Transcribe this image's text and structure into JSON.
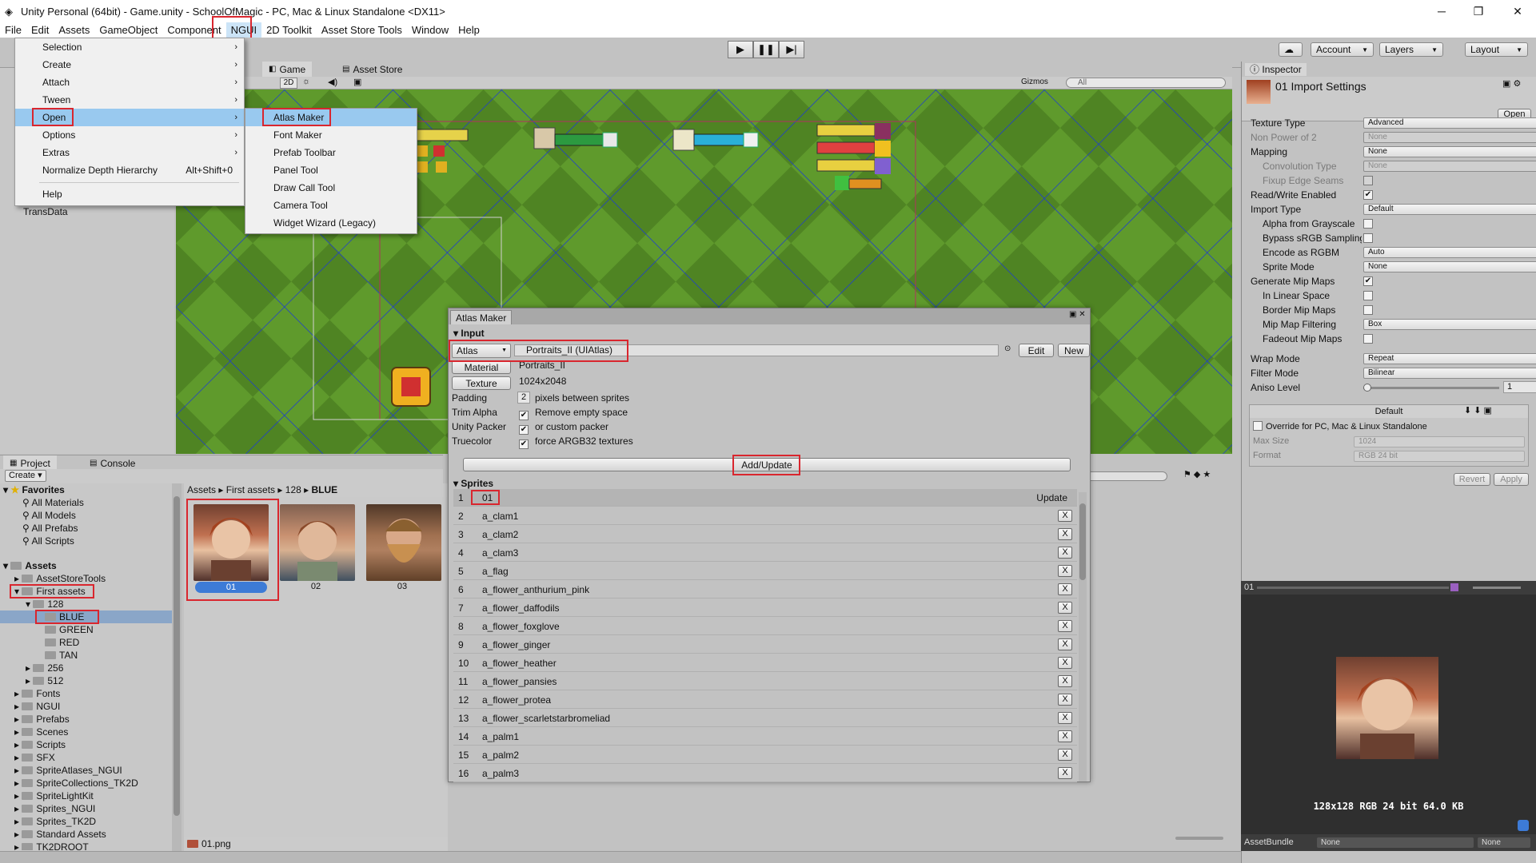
{
  "window": {
    "title": "Unity Personal (64bit) - Game.unity - SchoolOfMagic - PC, Mac & Linux Standalone <DX11>",
    "minimize": "─",
    "maximize": "❐",
    "close": "✕"
  },
  "menubar": [
    "File",
    "Edit",
    "Assets",
    "GameObject",
    "Component",
    "NGUI",
    "2D Toolkit",
    "Asset Store Tools",
    "Window",
    "Help"
  ],
  "toolbar": {
    "account": "Account",
    "layers": "Layers",
    "layout": "Layout"
  },
  "game_tabs": {
    "game": "Game",
    "asset_store": "Asset Store",
    "mode_2d": "2D",
    "gizmos": "Gizmos",
    "search_placeholder": "All"
  },
  "hierarchy": {
    "visible_item": "TransData"
  },
  "ngui_menu": {
    "items": [
      {
        "label": "Selection",
        "arrow": "›"
      },
      {
        "label": "Create",
        "arrow": "›"
      },
      {
        "label": "Attach",
        "arrow": "›"
      },
      {
        "label": "Tween",
        "arrow": "›"
      },
      {
        "label": "Open",
        "arrow": "›"
      },
      {
        "label": "Options",
        "arrow": "›"
      },
      {
        "label": "Extras",
        "arrow": "›"
      },
      {
        "label": "Normalize Depth Hierarchy",
        "accel": "Alt+Shift+0"
      },
      {
        "label": "Help"
      }
    ]
  },
  "open_submenu": {
    "items": [
      "Atlas Maker",
      "Font Maker",
      "Prefab Toolbar",
      "Panel Tool",
      "Draw Call Tool",
      "Camera Tool",
      "Widget Wizard (Legacy)"
    ]
  },
  "project": {
    "tab_project": "Project",
    "tab_console": "Console",
    "create": "Create",
    "breadcrumb": [
      "Assets",
      "First assets",
      "128",
      "BLUE"
    ],
    "favorites": {
      "title": "Favorites",
      "items": [
        "All Materials",
        "All Models",
        "All Prefabs",
        "All Scripts"
      ]
    },
    "assets_title": "Assets",
    "tree": [
      "AssetStoreTools",
      "First assets",
      "128",
      "BLUE",
      "GREEN",
      "RED",
      "TAN",
      "256",
      "512",
      "Fonts",
      "NGUI",
      "Prefabs",
      "Scenes",
      "Scripts",
      "SFX",
      "SpriteAtlases_NGUI",
      "SpriteCollections_TK2D",
      "SpriteLightKit",
      "Sprites_NGUI",
      "Sprites_TK2D",
      "Standard Assets",
      "TK2DROOT"
    ],
    "thumbs": [
      "01",
      "02",
      "03"
    ],
    "footer_file": "01.png"
  },
  "atlas_maker": {
    "title": "Atlas Maker",
    "input_header": "Input",
    "atlas_label": "Atlas",
    "atlas_value": "Portraits_II (UIAtlas)",
    "edit": "Edit",
    "new": "New",
    "material_label": "Material",
    "material_value": "Portraits_II",
    "texture_label": "Texture",
    "texture_value": "1024x2048",
    "padding_label": "Padding",
    "padding_value": "2",
    "padding_text": "pixels between sprites",
    "trim_label": "Trim Alpha",
    "trim_text": "Remove empty space",
    "unity_label": "Unity Packer",
    "unity_text": "or custom packer",
    "truecolor_label": "Truecolor",
    "truecolor_text": "force ARGB32 textures",
    "add_update": "Add/Update",
    "sprites_header": "Sprites",
    "update": "Update",
    "sprites": [
      {
        "n": "1",
        "name": "01"
      },
      {
        "n": "2",
        "name": "a_clam1"
      },
      {
        "n": "3",
        "name": "a_clam2"
      },
      {
        "n": "4",
        "name": "a_clam3"
      },
      {
        "n": "5",
        "name": "a_flag"
      },
      {
        "n": "6",
        "name": "a_flower_anthurium_pink"
      },
      {
        "n": "7",
        "name": "a_flower_daffodils"
      },
      {
        "n": "8",
        "name": "a_flower_foxglove"
      },
      {
        "n": "9",
        "name": "a_flower_ginger"
      },
      {
        "n": "10",
        "name": "a_flower_heather"
      },
      {
        "n": "11",
        "name": "a_flower_pansies"
      },
      {
        "n": "12",
        "name": "a_flower_protea"
      },
      {
        "n": "13",
        "name": "a_flower_scarletstarbromeliad"
      },
      {
        "n": "14",
        "name": "a_palm1"
      },
      {
        "n": "15",
        "name": "a_palm2"
      },
      {
        "n": "16",
        "name": "a_palm3"
      }
    ]
  },
  "inspector": {
    "tab": "Inspector",
    "title": "01 Import Settings",
    "open": "Open",
    "rows": [
      {
        "label": "Texture Type",
        "field": "Advanced"
      },
      {
        "label": "Non Power of 2",
        "field": "None",
        "disabled": true
      },
      {
        "label": "Mapping",
        "field": "None"
      },
      {
        "label": "Convolution Type",
        "field": "None",
        "disabled": true,
        "indent": true
      },
      {
        "label": "Fixup Edge Seams",
        "check": "",
        "disabled": true,
        "indent": true
      },
      {
        "label": "Read/Write Enabled",
        "check": "✔"
      },
      {
        "label": "Import Type",
        "field": "Default"
      },
      {
        "label": "Alpha from Grayscale",
        "check": "",
        "indent": true
      },
      {
        "label": "Bypass sRGB Sampling",
        "check": "",
        "indent": true
      },
      {
        "label": "Encode as RGBM",
        "field": "Auto",
        "indent": true
      },
      {
        "label": "Sprite Mode",
        "field": "None",
        "indent": true
      },
      {
        "label": "Generate Mip Maps",
        "check": "✔"
      },
      {
        "label": "In Linear Space",
        "check": "",
        "indent": true
      },
      {
        "label": "Border Mip Maps",
        "check": "",
        "indent": true
      },
      {
        "label": "Mip Map Filtering",
        "field": "Box",
        "indent": true
      },
      {
        "label": "Fadeout Mip Maps",
        "check": "",
        "indent": true
      }
    ],
    "wrap_label": "Wrap Mode",
    "wrap_value": "Repeat",
    "filter_label": "Filter Mode",
    "filter_value": "Bilinear",
    "aniso_label": "Aniso Level",
    "aniso_value": "1",
    "aniso_fraction": 0.0,
    "platform_default": "Default",
    "override_label": "Override for PC, Mac & Linux Standalone",
    "max_size_label": "Max Size",
    "max_size_value": "1024",
    "format_label": "Format",
    "format_value": "RGB 24 bit",
    "revert": "Revert",
    "apply": "Apply",
    "preview_name": "01",
    "preview_info": "128x128  RGB 24 bit   64.0 KB",
    "assetbundle_label": "AssetBundle",
    "assetbundle_value": "None",
    "assetbundle_variant": "None"
  },
  "colors": {
    "highlight": "#99c9ef",
    "annotation_red": "#d9262e",
    "grass": "#5a8c2b",
    "selection_blue": "#3d7bd6"
  }
}
